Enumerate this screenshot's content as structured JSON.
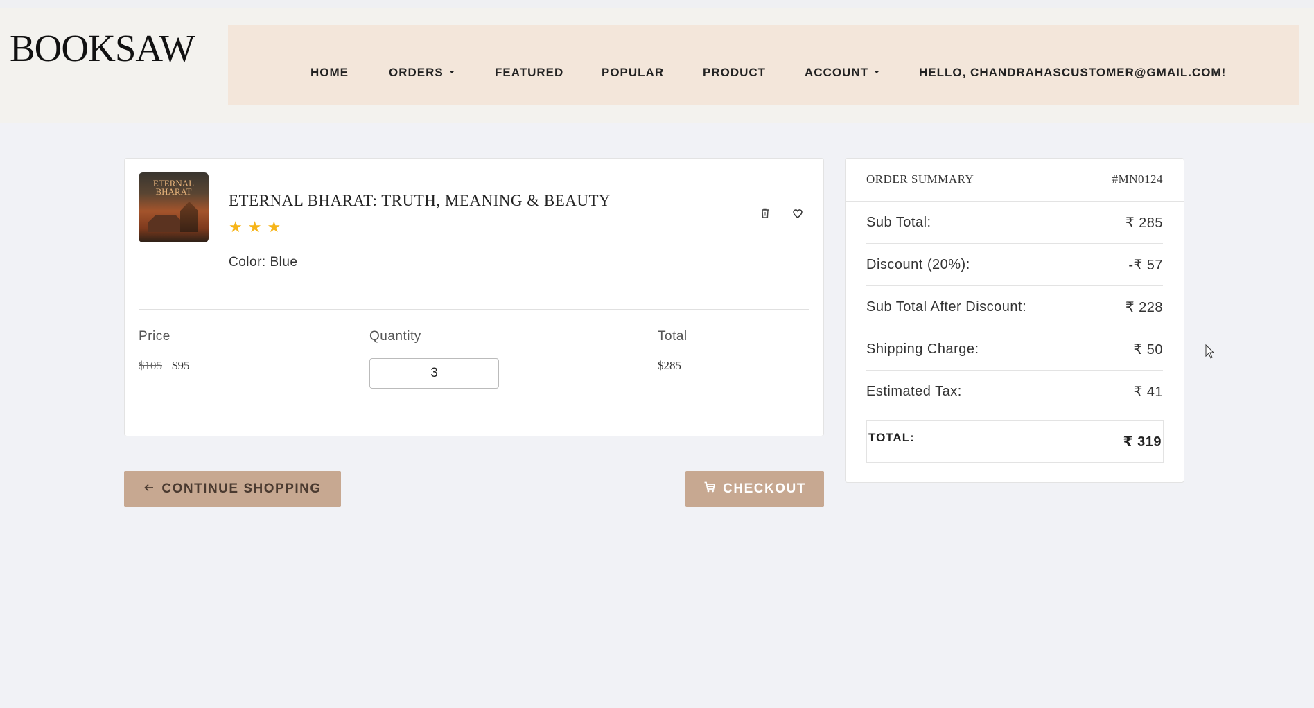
{
  "brand": {
    "logo_bold": "BOOK",
    "logo_thin": "SAW"
  },
  "nav": {
    "home": "HOME",
    "orders": "ORDERS",
    "featured": "FEATURED",
    "popular": "POPULAR",
    "product": "PRODUCT",
    "account": "ACCOUNT",
    "greeting": "HELLO, CHANDRAHASCUSTOMER@GMAIL.COM!"
  },
  "cart_item": {
    "cover_title_line1": "ETERNAL",
    "cover_title_line2": "BHARAT",
    "title": "ETERNAL BHARAT: TRUTH, MEANING & BEAUTY",
    "rating": 3,
    "color_label": "Color: Blue",
    "price_label": "Price",
    "quantity_label": "Quantity",
    "total_label": "Total",
    "old_price": "$105",
    "price": "$95",
    "quantity": "3",
    "total": "$285",
    "icons": [
      "trash-icon",
      "heart-icon"
    ]
  },
  "actions": {
    "continue_label": "CONTINUE SHOPPING",
    "checkout_label": "CHECKOUT"
  },
  "summary": {
    "title": "ORDER SUMMARY",
    "order_id": "#MN0124",
    "rows": [
      {
        "label": "Sub Total:",
        "value": "₹ 285"
      },
      {
        "label": "Discount (20%):",
        "value": "-₹ 57"
      },
      {
        "label": "Sub Total After Discount:",
        "value": "₹ 228"
      },
      {
        "label": "Shipping Charge:",
        "value": "₹ 50"
      },
      {
        "label": "Estimated Tax:",
        "value": "₹ 41"
      }
    ],
    "total_label": "TOTAL:",
    "total_value": "₹ 319"
  },
  "colors": {
    "accent": "#c7a891",
    "nav_bg": "#f3e6da",
    "star": "#f6b418",
    "page_bg": "#f1f2f6"
  }
}
